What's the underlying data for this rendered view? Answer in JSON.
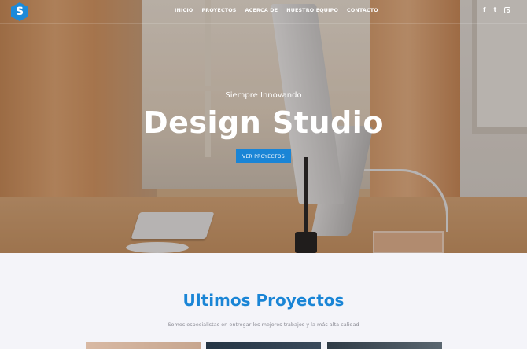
{
  "brand": {
    "logo_letter": "S"
  },
  "nav": {
    "items": [
      {
        "label": "INICIO"
      },
      {
        "label": "PROYECTOS"
      },
      {
        "label": "ACERCA DE"
      },
      {
        "label": "NUESTRO EQUIPO"
      },
      {
        "label": "CONTACTO"
      }
    ],
    "socials": [
      {
        "icon": "facebook-icon",
        "glyph": "f"
      },
      {
        "icon": "twitter-icon",
        "glyph": "t"
      },
      {
        "icon": "instagram-icon",
        "glyph": ""
      }
    ]
  },
  "hero": {
    "tagline": "Siempre Innovando",
    "headline": "Design Studio",
    "cta_label": "VER PROYECTOS"
  },
  "projects": {
    "title": "Ultimos Proyectos",
    "subtitle": "Somos especialistas en entregar los mejores trabajos y la más alta calidad"
  },
  "colors": {
    "accent": "#1a85d6",
    "muted_text": "#8a8a93",
    "section_bg": "#f4f4f9"
  }
}
